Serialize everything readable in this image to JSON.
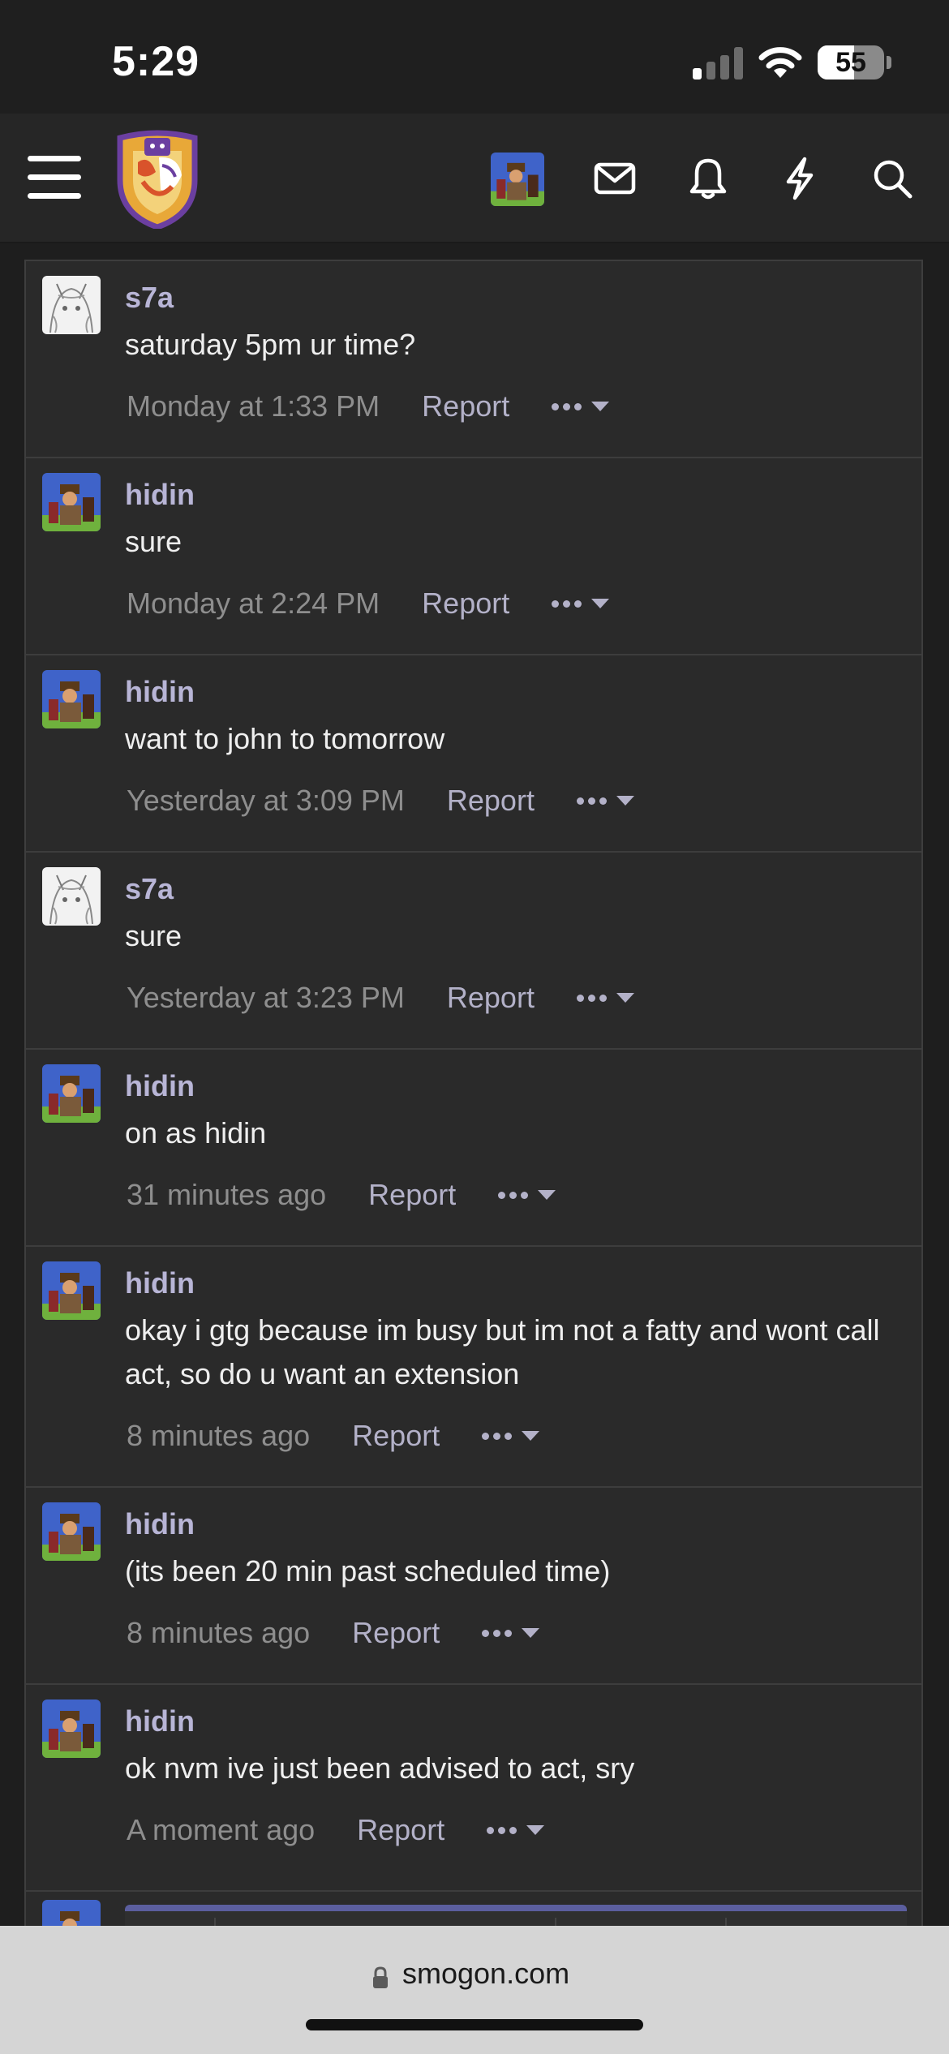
{
  "status_bar": {
    "time": "5:29",
    "battery_percent": "55",
    "battery_level": 0.55,
    "signal_bars_active": 1
  },
  "nav": {
    "menu_icon": "hamburger-menu-icon",
    "logo": "smogon-logo",
    "avatar": "user-avatar",
    "icons": [
      "envelope-icon",
      "bell-icon",
      "lightning-icon",
      "search-icon"
    ]
  },
  "messages": [
    {
      "user": "s7a",
      "text": "saturday 5pm ur time?",
      "time": "Monday at 1:33 PM",
      "report": "Report",
      "avatar": "s7a"
    },
    {
      "user": "hidin",
      "text": "sure",
      "time": "Monday at 2:24 PM",
      "report": "Report",
      "avatar": "hidin"
    },
    {
      "user": "hidin",
      "text": "want to john to tomorrow",
      "time": "Yesterday at 3:09 PM",
      "report": "Report",
      "avatar": "hidin"
    },
    {
      "user": "s7a",
      "text": "sure",
      "time": "Yesterday at 3:23 PM",
      "report": "Report",
      "avatar": "s7a"
    },
    {
      "user": "hidin",
      "text": "on as hidin",
      "time": "31 minutes ago",
      "report": "Report",
      "avatar": "hidin"
    },
    {
      "user": "hidin",
      "text": "okay i gtg because im busy but im not a fatty and wont call act, so do u want an extension",
      "time": "8 minutes ago",
      "report": "Report",
      "avatar": "hidin"
    },
    {
      "user": "hidin",
      "text": "(its been 20 min past scheduled time)",
      "time": "8 minutes ago",
      "report": "Report",
      "avatar": "hidin"
    },
    {
      "user": "hidin",
      "text": "ok nvm ive just been advised to act, sry",
      "time": "A moment ago",
      "report": "Report",
      "avatar": "hidin"
    }
  ],
  "url_bar": {
    "domain": "smogon.com"
  },
  "colors": {
    "accent": "#5b5e9e",
    "username": "#b8b5d6",
    "background": "#2a2a2a"
  }
}
